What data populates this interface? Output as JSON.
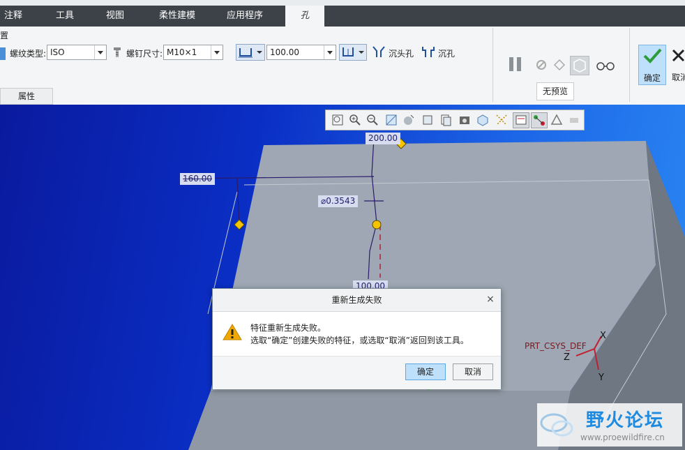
{
  "ribbon": {
    "tabs": [
      "注释",
      "工具",
      "视图",
      "柔性建模",
      "应用程序",
      "孔"
    ],
    "section_label": "置",
    "thread_type_label": "螺纹类型:",
    "thread_type_value": "ISO",
    "screw_size_label": "螺钉尺寸:",
    "screw_size_value": "M10×1",
    "depth_value": "100.00",
    "countersink_label": "沉头孔",
    "counterbore_label": "沉孔",
    "properties_tab": "属性",
    "no_preview_label": "无预览",
    "ok_label": "确定",
    "cancel_label": "取消"
  },
  "viewport": {
    "dims": [
      "200.00",
      "160.00",
      "100.00"
    ],
    "diameter_label": "⌀0.3543",
    "csys_label": "PRT_CSYS_DEF",
    "axis_x": "X",
    "axis_y": "Y",
    "axis_z": "Z"
  },
  "dialog": {
    "title": "重新生成失败",
    "line1": "特征重新生成失败。",
    "line2": "选取“确定”创建失败的特征，或选取“取消”返回到该工具。",
    "ok": "确定",
    "cancel": "取消"
  },
  "watermark": {
    "title": "野火论坛",
    "url": "www.proewildfire.cn"
  },
  "colors": {
    "tab_bar": "#3c4248",
    "dialog_primary": "#bfe0fb",
    "part_top": "#9ea7b3",
    "part_side": "#6f7782",
    "warning": "#f0a800"
  }
}
